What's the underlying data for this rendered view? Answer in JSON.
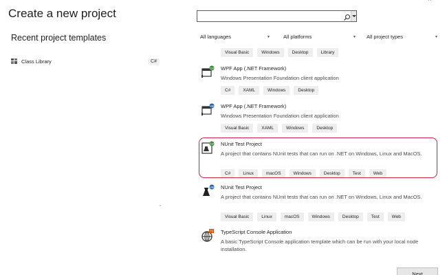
{
  "window": {
    "controls": "–  ×"
  },
  "page": {
    "title": "Create a new project"
  },
  "recent": {
    "heading": "Recent project templates",
    "items": [
      {
        "label": "Class Library",
        "language": "C#"
      }
    ]
  },
  "search": {
    "value": "",
    "placeholder": ""
  },
  "filters": [
    {
      "label": "All languages"
    },
    {
      "label": "All platforms"
    },
    {
      "label": "All project types"
    }
  ],
  "templates": [
    {
      "name": "",
      "desc": "",
      "tags": [
        "Visual Basic",
        "Windows",
        "Desktop",
        "Library"
      ]
    },
    {
      "name": "WPF App (.NET Framework)",
      "desc": "Windows Presentation Foundation client application",
      "icon": "wpf-csharp-icon",
      "badge": "C#",
      "tags": [
        "C#",
        "XAML",
        "Windows",
        "Desktop"
      ]
    },
    {
      "name": "WPF App (.NET Framework)",
      "desc": "Windows Presentation Foundation client application",
      "icon": "wpf-vb-icon",
      "badge": "VB",
      "tags": [
        "Visual Basic",
        "XAML",
        "Windows",
        "Desktop"
      ]
    },
    {
      "name": "NUnit Test Project",
      "desc": "A project that contains NUnit tests that can run on .NET on Windows, Linux and MacOS.",
      "icon": "nunit-csharp-icon",
      "badge": "C#",
      "tags": [
        "C#",
        "Linux",
        "macOS",
        "Windows",
        "Desktop",
        "Test",
        "Web"
      ]
    },
    {
      "name": "NUnit Test Project",
      "desc": "A project that contains NUnit tests that can run on .NET on Windows, Linux and MacOS.",
      "icon": "nunit-vb-icon",
      "badge": "VB",
      "tags": [
        "Visual Basic",
        "Linux",
        "macOS",
        "Windows",
        "Desktop",
        "Test",
        "Web"
      ]
    },
    {
      "name": "TypeScript Console Application",
      "desc": "A basic TypeScript Console application template which can be run with your local node installation.",
      "icon": "typescript-console-icon",
      "badge": "TS",
      "tags": []
    }
  ],
  "colors": {
    "highlight": "#d0213a",
    "csharp_badge": "#388a34",
    "vb_badge": "#1f5fb4",
    "ts_badge": "#d35400"
  },
  "footer": {
    "next_label": "Next"
  }
}
